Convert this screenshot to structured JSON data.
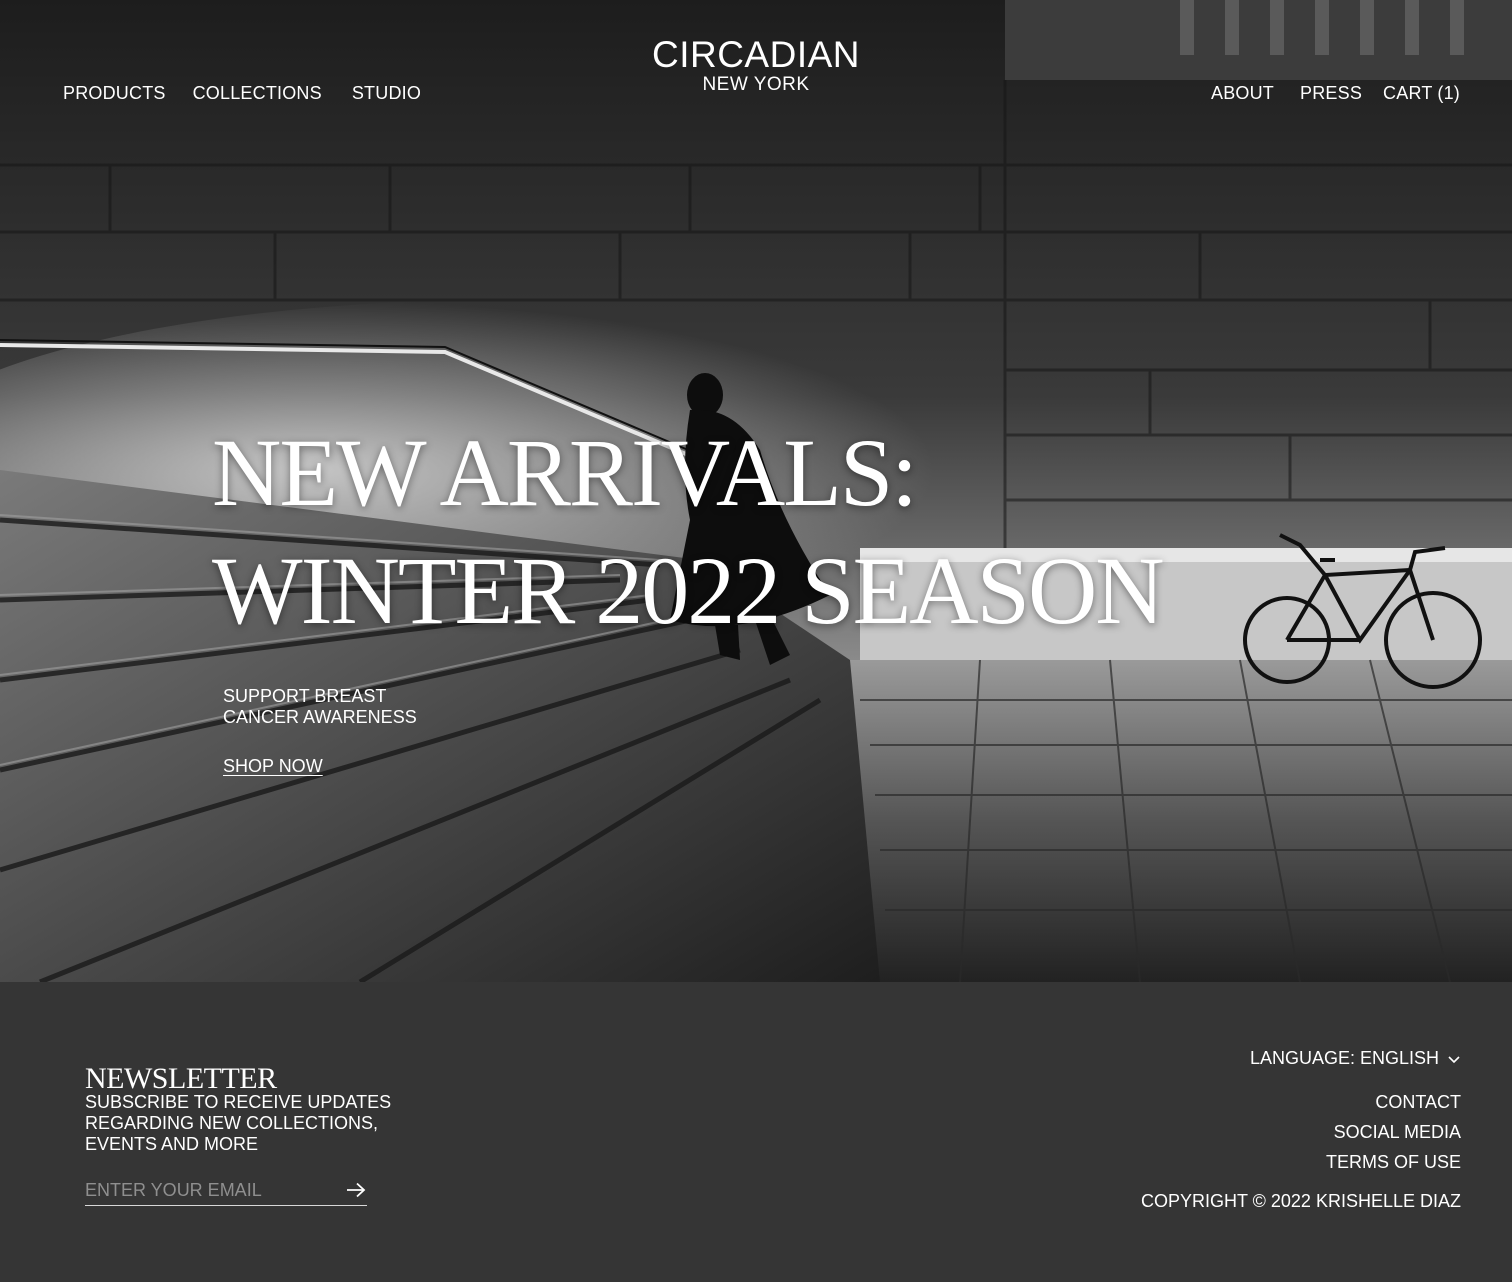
{
  "nav": {
    "left": [
      "PRODUCTS",
      "COLLECTIONS",
      "STUDIO"
    ],
    "right": [
      "ABOUT",
      "PRESS",
      "CART (1)"
    ]
  },
  "logo": {
    "brand": "CIRCADIAN",
    "city": "NEW YORK"
  },
  "hero": {
    "headline_line1": "NEW ARRIVALS:",
    "headline_line2": "WINTER 2022 SEASON",
    "subtext": "SUPPORT BREAST CANCER AWARENESS",
    "cta": "SHOP NOW"
  },
  "footer": {
    "newsletter_title": "NEWSLETTER",
    "newsletter_desc": "SUBSCRIBE TO RECEIVE UPDATES REGARDING NEW COLLECTIONS, EVENTS AND MORE",
    "email_placeholder": "ENTER YOUR EMAIL",
    "language": "LANGUAGE: ENGLISH",
    "links": [
      "CONTACT",
      "SOCIAL MEDIA",
      "TERMS OF USE"
    ],
    "copyright": "COPYRIGHT © 2022 KRISHELLE DIAZ"
  },
  "colors": {
    "footer_bg": "#353535",
    "text": "#ffffff",
    "placeholder": "#8f8f8f"
  },
  "icons": {
    "submit": "arrow-right-icon",
    "language": "chevron-down-icon"
  }
}
